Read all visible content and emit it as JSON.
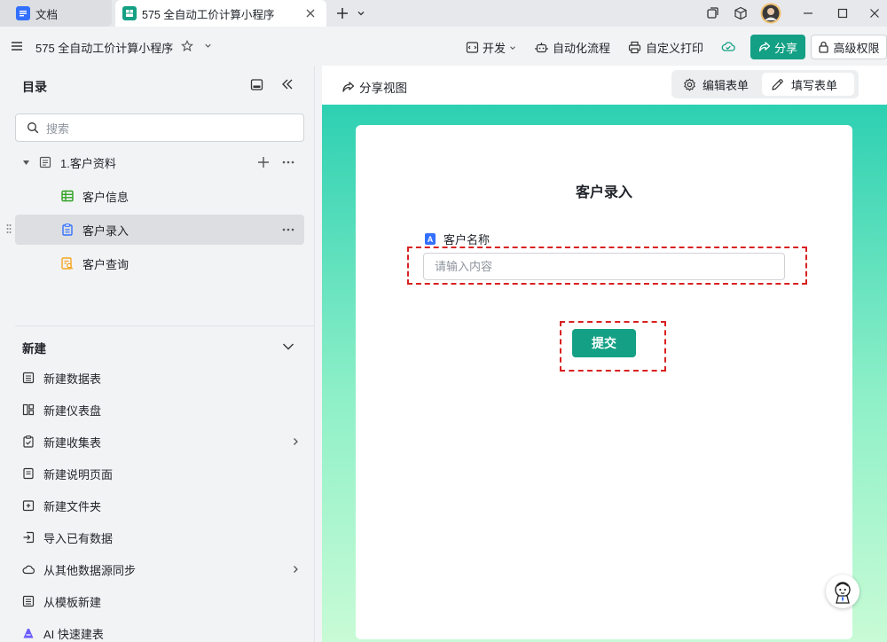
{
  "browser": {
    "tabs": [
      {
        "label": "文档",
        "icon": "doc-icon"
      },
      {
        "label": "575 全自动工价计算小程序",
        "icon": "app-icon",
        "active": true
      }
    ]
  },
  "header": {
    "title": "575 全自动工价计算小程序",
    "dev_label": "开发",
    "automation_label": "自动化流程",
    "print_label": "自定义打印",
    "share_label": "分享",
    "permission_label": "高级权限"
  },
  "sidebar": {
    "title": "目录",
    "search_placeholder": "搜索",
    "group": {
      "label": "1.客户资料"
    },
    "items": [
      {
        "label": "客户信息",
        "icon": "table-icon",
        "color": "#2ea121"
      },
      {
        "label": "客户录入",
        "icon": "form-icon",
        "color": "#3370ff"
      },
      {
        "label": "客户查询",
        "icon": "query-icon",
        "color": "#f5a623"
      }
    ],
    "new_section": {
      "title": "新建",
      "items": [
        {
          "label": "新建数据表",
          "icon": "datatable-icon"
        },
        {
          "label": "新建仪表盘",
          "icon": "dashboard-icon"
        },
        {
          "label": "新建收集表",
          "icon": "collect-form-icon",
          "has_submenu": true
        },
        {
          "label": "新建说明页面",
          "icon": "page-icon"
        },
        {
          "label": "新建文件夹",
          "icon": "folder-icon"
        },
        {
          "label": "导入已有数据",
          "icon": "import-icon"
        },
        {
          "label": "从其他数据源同步",
          "icon": "cloud-icon",
          "has_submenu": true
        },
        {
          "label": "从模板新建",
          "icon": "template-icon"
        },
        {
          "label": "AI 快速建表",
          "icon": "ai-icon"
        }
      ]
    }
  },
  "main": {
    "share_view_label": "分享视图",
    "edit_form_label": "编辑表单",
    "fill_form_label": "填写表单",
    "form": {
      "title": "客户录入",
      "field_label": "客户名称",
      "field_badge": "A",
      "field_placeholder": "请输入内容",
      "submit_label": "提交"
    }
  },
  "colors": {
    "accent": "#14a085",
    "annotation": "#d92020"
  }
}
